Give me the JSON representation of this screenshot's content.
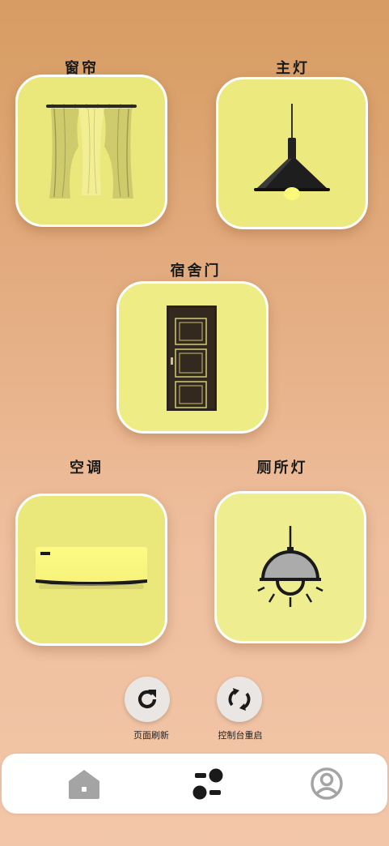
{
  "devices": {
    "curtain": {
      "label": "窗帘",
      "icon": "curtain-icon"
    },
    "main_light": {
      "label": "主灯",
      "icon": "pendant-lamp-icon"
    },
    "dorm_door": {
      "label": "宿舍门",
      "icon": "door-icon"
    },
    "air_conditioner": {
      "label": "空调",
      "icon": "air-conditioner-icon"
    },
    "toilet_light": {
      "label": "厕所灯",
      "icon": "dome-lamp-icon"
    }
  },
  "actions": {
    "refresh": {
      "label": "页面刷新",
      "icon": "refresh-icon"
    },
    "restart": {
      "label": "控制台重启",
      "icon": "restart-icon"
    }
  },
  "bottom_nav": {
    "items": [
      {
        "name": "home",
        "icon": "home-icon",
        "active": false
      },
      {
        "name": "control",
        "icon": "control-icon",
        "active": true
      },
      {
        "name": "profile",
        "icon": "user-icon",
        "active": false
      }
    ]
  },
  "colors": {
    "card_yellow": "#ece97f",
    "card_yellow_light": "#eeee90",
    "nav_active": "#1a1a1a",
    "nav_inactive": "#a4a4a4"
  }
}
